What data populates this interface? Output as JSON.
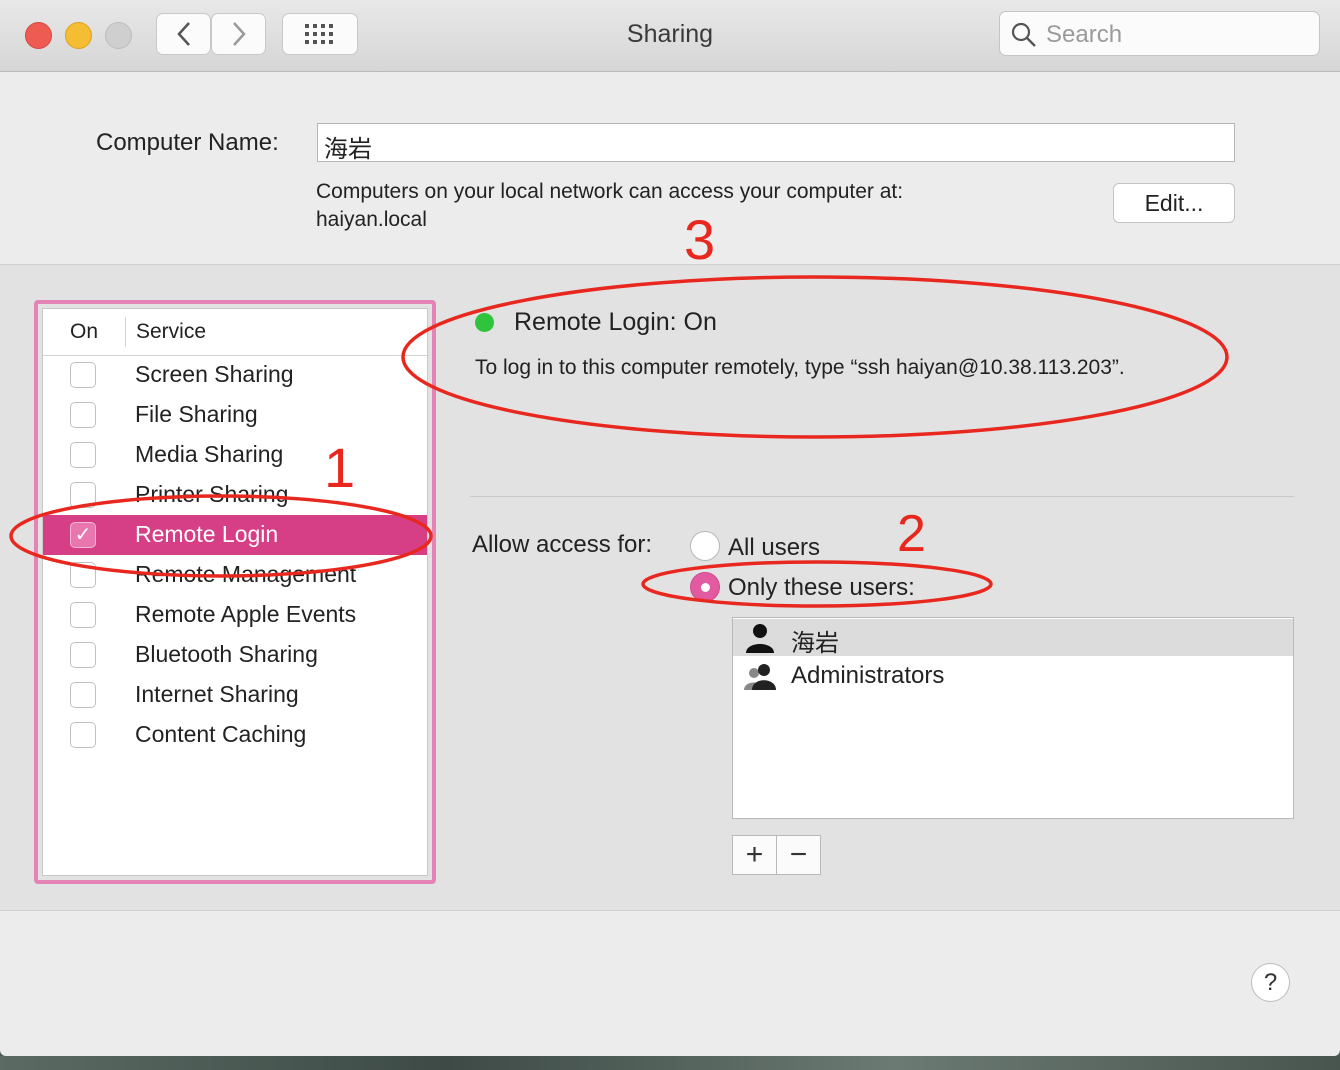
{
  "window": {
    "title": "Sharing"
  },
  "toolbar": {
    "back_icon": "chevron-left-icon",
    "forward_icon": "chevron-right-icon",
    "grid_icon": "grid-icon",
    "search_placeholder": "Search"
  },
  "computer_name": {
    "label": "Computer Name:",
    "value": "海岩",
    "access_line1": "Computers on your local network can access your computer at:",
    "access_line2": "haiyan.local",
    "edit_label": "Edit..."
  },
  "services": {
    "header_on": "On",
    "header_service": "Service",
    "items": [
      {
        "label": "Screen Sharing",
        "checked": false
      },
      {
        "label": "File Sharing",
        "checked": false
      },
      {
        "label": "Media Sharing",
        "checked": false
      },
      {
        "label": "Printer Sharing",
        "checked": false
      },
      {
        "label": "Remote Login",
        "checked": true,
        "selected": true,
        "check_glyph": "✓"
      },
      {
        "label": "Remote Management",
        "checked": false
      },
      {
        "label": "Remote Apple Events",
        "checked": false
      },
      {
        "label": "Bluetooth Sharing",
        "checked": false
      },
      {
        "label": "Internet Sharing",
        "checked": false
      },
      {
        "label": "Content Caching",
        "checked": false
      }
    ]
  },
  "status": {
    "title": "Remote Login: On",
    "description": "To log in to this computer remotely, type “ssh haiyan@10.38.113.203”.",
    "color": "#2fc43b"
  },
  "access": {
    "label": "Allow access for:",
    "option_all": "All users",
    "option_only": "Only these users:",
    "selected": "only"
  },
  "users": [
    {
      "name": "海岩",
      "icon": "user-icon",
      "selected": true
    },
    {
      "name": "Administrators",
      "icon": "group-icon",
      "selected": false
    }
  ],
  "buttons": {
    "add": "+",
    "remove": "−",
    "help": "?"
  },
  "annotations": {
    "one": "1",
    "two": "2",
    "three": "3",
    "color": "#e8281e"
  },
  "colors": {
    "accent": "#d63f86",
    "frame": "#e383b6"
  }
}
